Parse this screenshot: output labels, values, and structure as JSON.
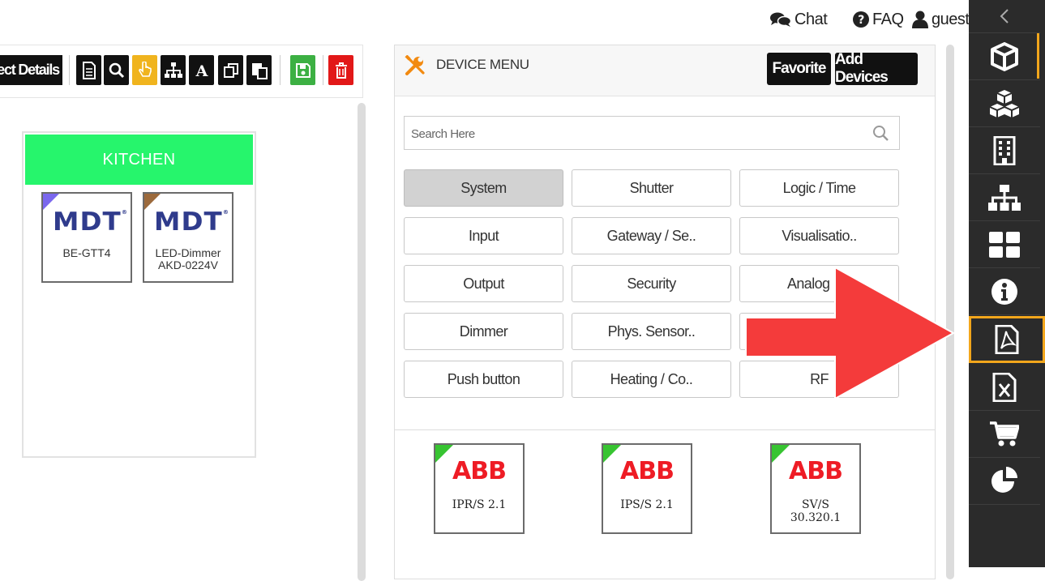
{
  "topbar": {
    "chat_label": "Chat",
    "faq_label": "FAQ",
    "user_label": "guest"
  },
  "toolbar": {
    "project_details_label": "ect Details",
    "buttons": [
      "document-icon",
      "search-icon",
      "pointer-hand-icon",
      "hierarchy-icon",
      "font-icon",
      "copy-icon",
      "paste-icon",
      "save-icon",
      "trash-icon"
    ]
  },
  "room": {
    "title": "KITCHEN",
    "devices": [
      {
        "brand": "MDT",
        "label_line1": "BE-GTT4",
        "label_line2": "",
        "corner_color": "#7b68ee"
      },
      {
        "brand": "MDT",
        "label_line1": "LED-Dimmer",
        "label_line2": "AKD-0224V",
        "corner_color": "#9c6a3c"
      }
    ]
  },
  "device_menu": {
    "title": "DEVICE MENU",
    "favorite_label": "Favorite",
    "add_devices_label": "Add Devices",
    "search_placeholder": "Search Here",
    "categories": [
      "System",
      "Shutter",
      "Logic / Time",
      "Input",
      "Gateway / Se..",
      "Visualisatio..",
      "Output",
      "Security",
      "Analog I/O",
      "Dimmer",
      "Phys. Sensor..",
      "",
      "Push button",
      "Heating / Co..",
      "RF"
    ],
    "active_category": "System",
    "devices": [
      {
        "brand": "ABB",
        "label_line1": "IPR/S 2.1",
        "label_line2": ""
      },
      {
        "brand": "ABB",
        "label_line1": "IPS/S 2.1",
        "label_line2": ""
      },
      {
        "brand": "ABB",
        "label_line1": "SV/S",
        "label_line2": "30.320.1"
      }
    ]
  },
  "sidebar": {
    "items": [
      "chevron-left-icon",
      "cube-icon",
      "cubes-icon",
      "building-icon",
      "sitemap-icon",
      "dashboard-icon",
      "info-icon",
      "pdf-file-icon",
      "excel-file-icon",
      "cart-icon",
      "pie-chart-icon"
    ],
    "selected": "pdf-file-icon"
  },
  "colors": {
    "accent": "#f2a61c",
    "room_header": "#26f56c",
    "arrow": "#f43b3b",
    "abb_red": "#ee1c25",
    "mdt_blue": "#2f3b8c"
  }
}
